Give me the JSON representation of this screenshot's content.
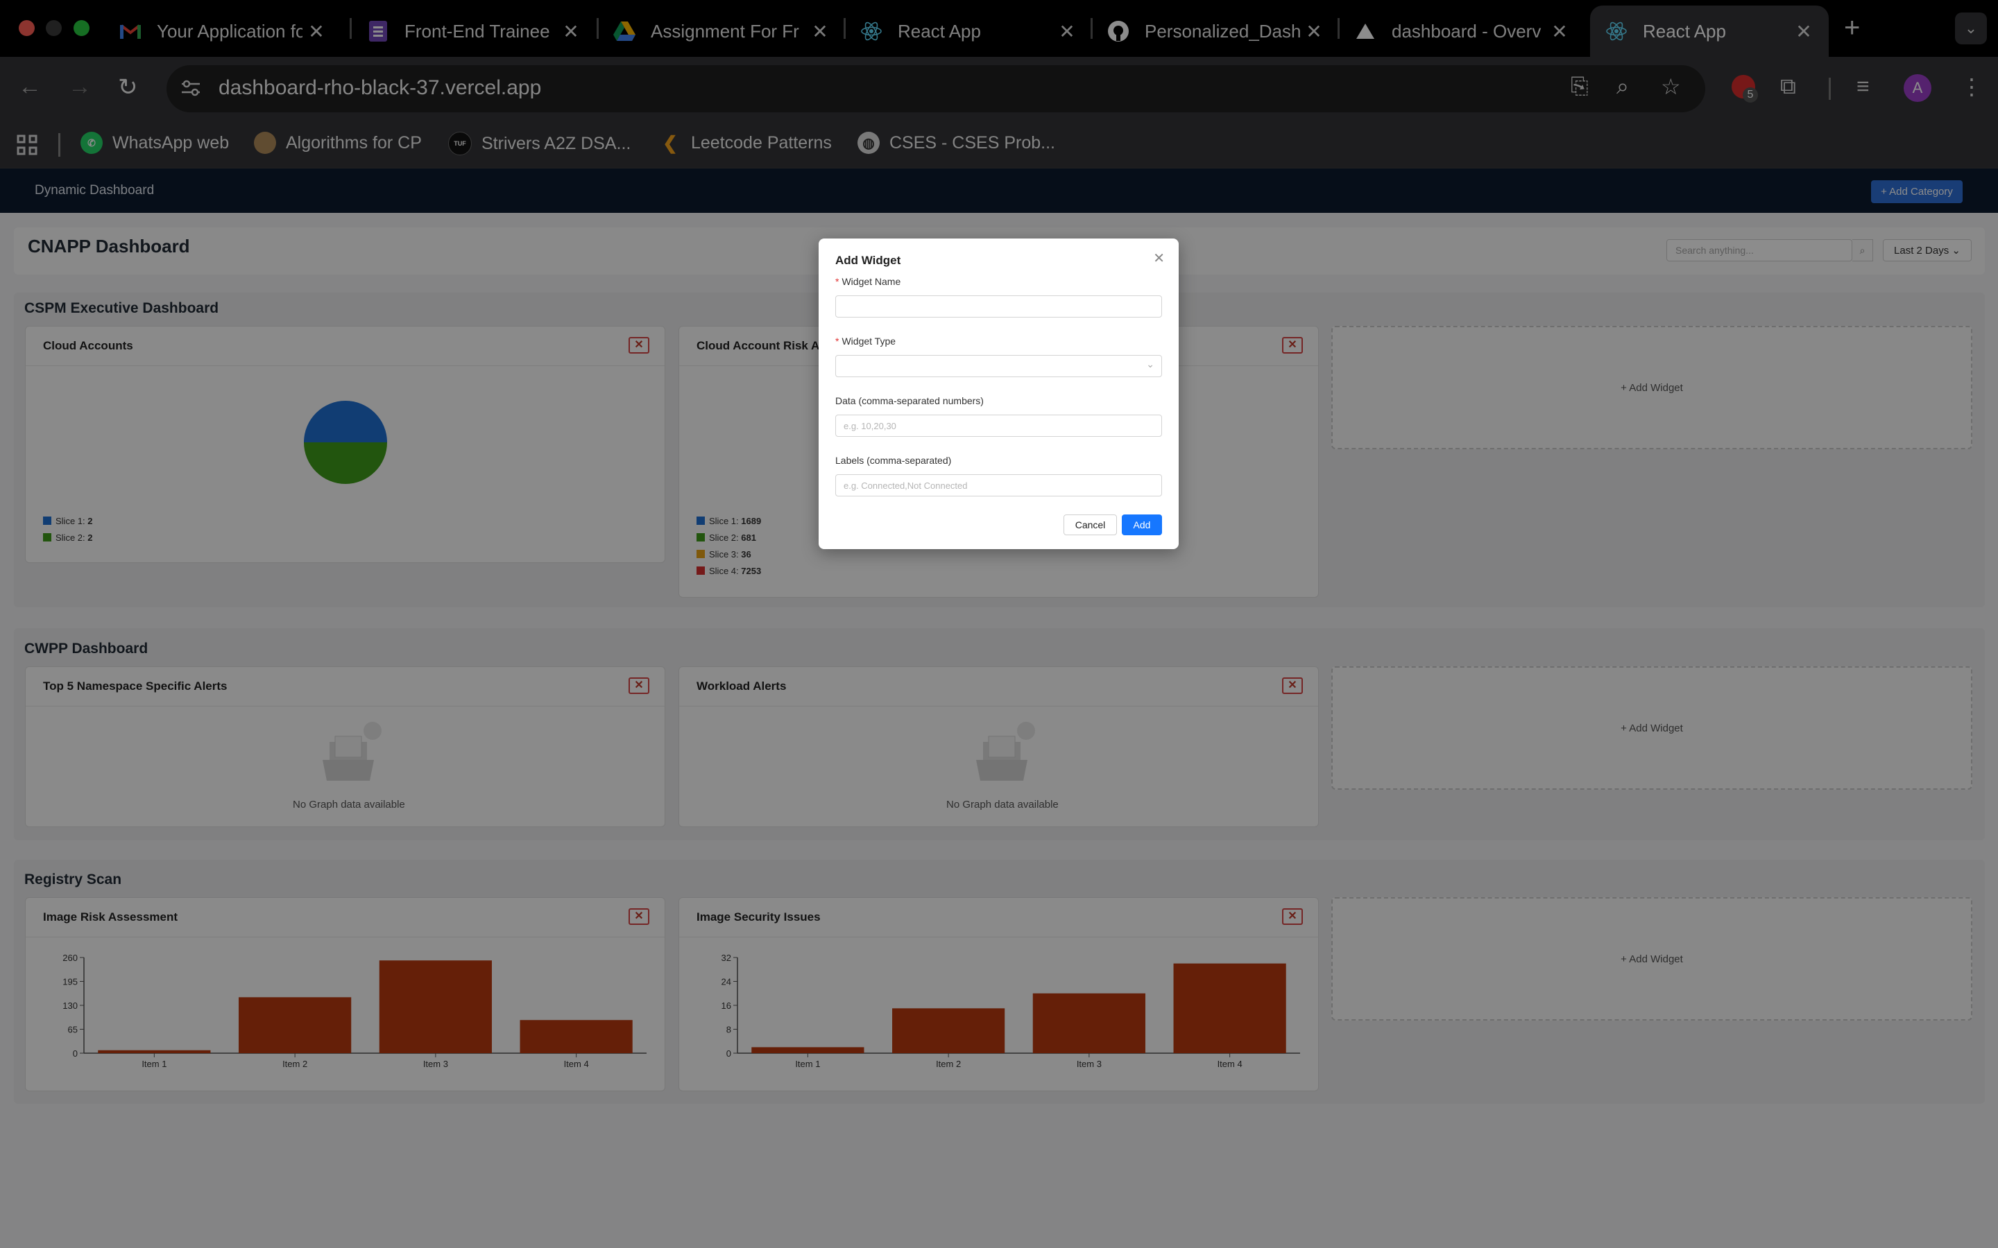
{
  "browser": {
    "tabs": [
      {
        "title": "Your Application fo",
        "icon": "gmail-icon"
      },
      {
        "title": "Front-End Trainee",
        "icon": "google-forms-icon"
      },
      {
        "title": "Assignment For Fr",
        "icon": "google-drive-icon"
      },
      {
        "title": "React App",
        "icon": "react-icon"
      },
      {
        "title": "Personalized_Dash",
        "icon": "github-icon"
      },
      {
        "title": "dashboard - Overv",
        "icon": "vercel-icon"
      },
      {
        "title": "React App",
        "icon": "react-icon"
      }
    ],
    "url": "dashboard-rho-black-37.vercel.app",
    "extension_badge": "5",
    "profile_initial": "A",
    "bookmarks": [
      {
        "label": "WhatsApp web",
        "icon": "whatsapp-icon"
      },
      {
        "label": "Algorithms for CP",
        "icon": "algorithms-icon"
      },
      {
        "label": "Strivers A2Z DSA...",
        "icon": "tuf-icon",
        "badge": "TUF"
      },
      {
        "label": "Leetcode Patterns",
        "icon": "leetcode-icon"
      },
      {
        "label": "CSES - CSES Prob...",
        "icon": "globe-icon"
      }
    ]
  },
  "app": {
    "nav_title": "Dynamic Dashboard",
    "add_category": "+ Add Category",
    "page_title": "CNAPP Dashboard",
    "search_placeholder": "Search anything...",
    "time_range": "Last 2 Days",
    "add_widget": "+ Add Widget",
    "no_data": "No Graph data available"
  },
  "sections": [
    {
      "title": "CSPM Executive Dashboard",
      "widgets": [
        {
          "title": "Cloud Accounts"
        },
        {
          "title": "Cloud Account Risk Assessment"
        }
      ]
    },
    {
      "title": "CWPP Dashboard",
      "widgets": [
        {
          "title": "Top 5 Namespace Specific Alerts"
        },
        {
          "title": "Workload Alerts"
        }
      ]
    },
    {
      "title": "Registry Scan",
      "widgets": [
        {
          "title": "Image Risk Assessment"
        },
        {
          "title": "Image Security Issues"
        }
      ]
    }
  ],
  "chart_data": [
    {
      "type": "pie",
      "title": "Cloud Accounts",
      "labels": [
        "Slice 1",
        "Slice 2"
      ],
      "values": [
        2,
        2
      ],
      "colors": [
        "#1f6fd1",
        "#3f9b1a"
      ],
      "legend": "bottom-left"
    },
    {
      "type": "pie",
      "title": "Cloud Account Risk Assessment",
      "labels": [
        "Slice 1",
        "Slice 2",
        "Slice 3",
        "Slice 4"
      ],
      "values": [
        1689,
        681,
        36,
        7253
      ],
      "colors": [
        "#1f6fd1",
        "#3f9b1a",
        "#e8a317",
        "#d63031"
      ],
      "legend": "bottom-left"
    },
    {
      "type": "bar",
      "title": "Image Risk Assessment",
      "categories": [
        "Item 1",
        "Item 2",
        "Item 3",
        "Item 4"
      ],
      "values": [
        8,
        152,
        252,
        90
      ],
      "yticks": [
        0,
        65,
        130,
        195,
        260
      ],
      "ylim": [
        0,
        260
      ],
      "color": "#b83a10",
      "grid": false
    },
    {
      "type": "bar",
      "title": "Image Security Issues",
      "categories": [
        "Item 1",
        "Item 2",
        "Item 3",
        "Item 4"
      ],
      "values": [
        2,
        15,
        20,
        30
      ],
      "yticks": [
        0,
        8,
        16,
        24,
        32
      ],
      "ylim": [
        0,
        32
      ],
      "color": "#b83a10",
      "grid": false
    }
  ],
  "modal": {
    "title": "Add Widget",
    "widget_name_label": "Widget Name",
    "widget_type_label": "Widget Type",
    "data_label": "Data (comma-separated numbers)",
    "data_placeholder": "e.g. 10,20,30",
    "labels_label": "Labels (comma-separated)",
    "labels_placeholder": "e.g. Connected,Not Connected",
    "cancel": "Cancel",
    "add": "Add"
  },
  "colors": {
    "primary": "#1677ff",
    "nav": "#0c1a2e",
    "danger": "#d64545"
  }
}
